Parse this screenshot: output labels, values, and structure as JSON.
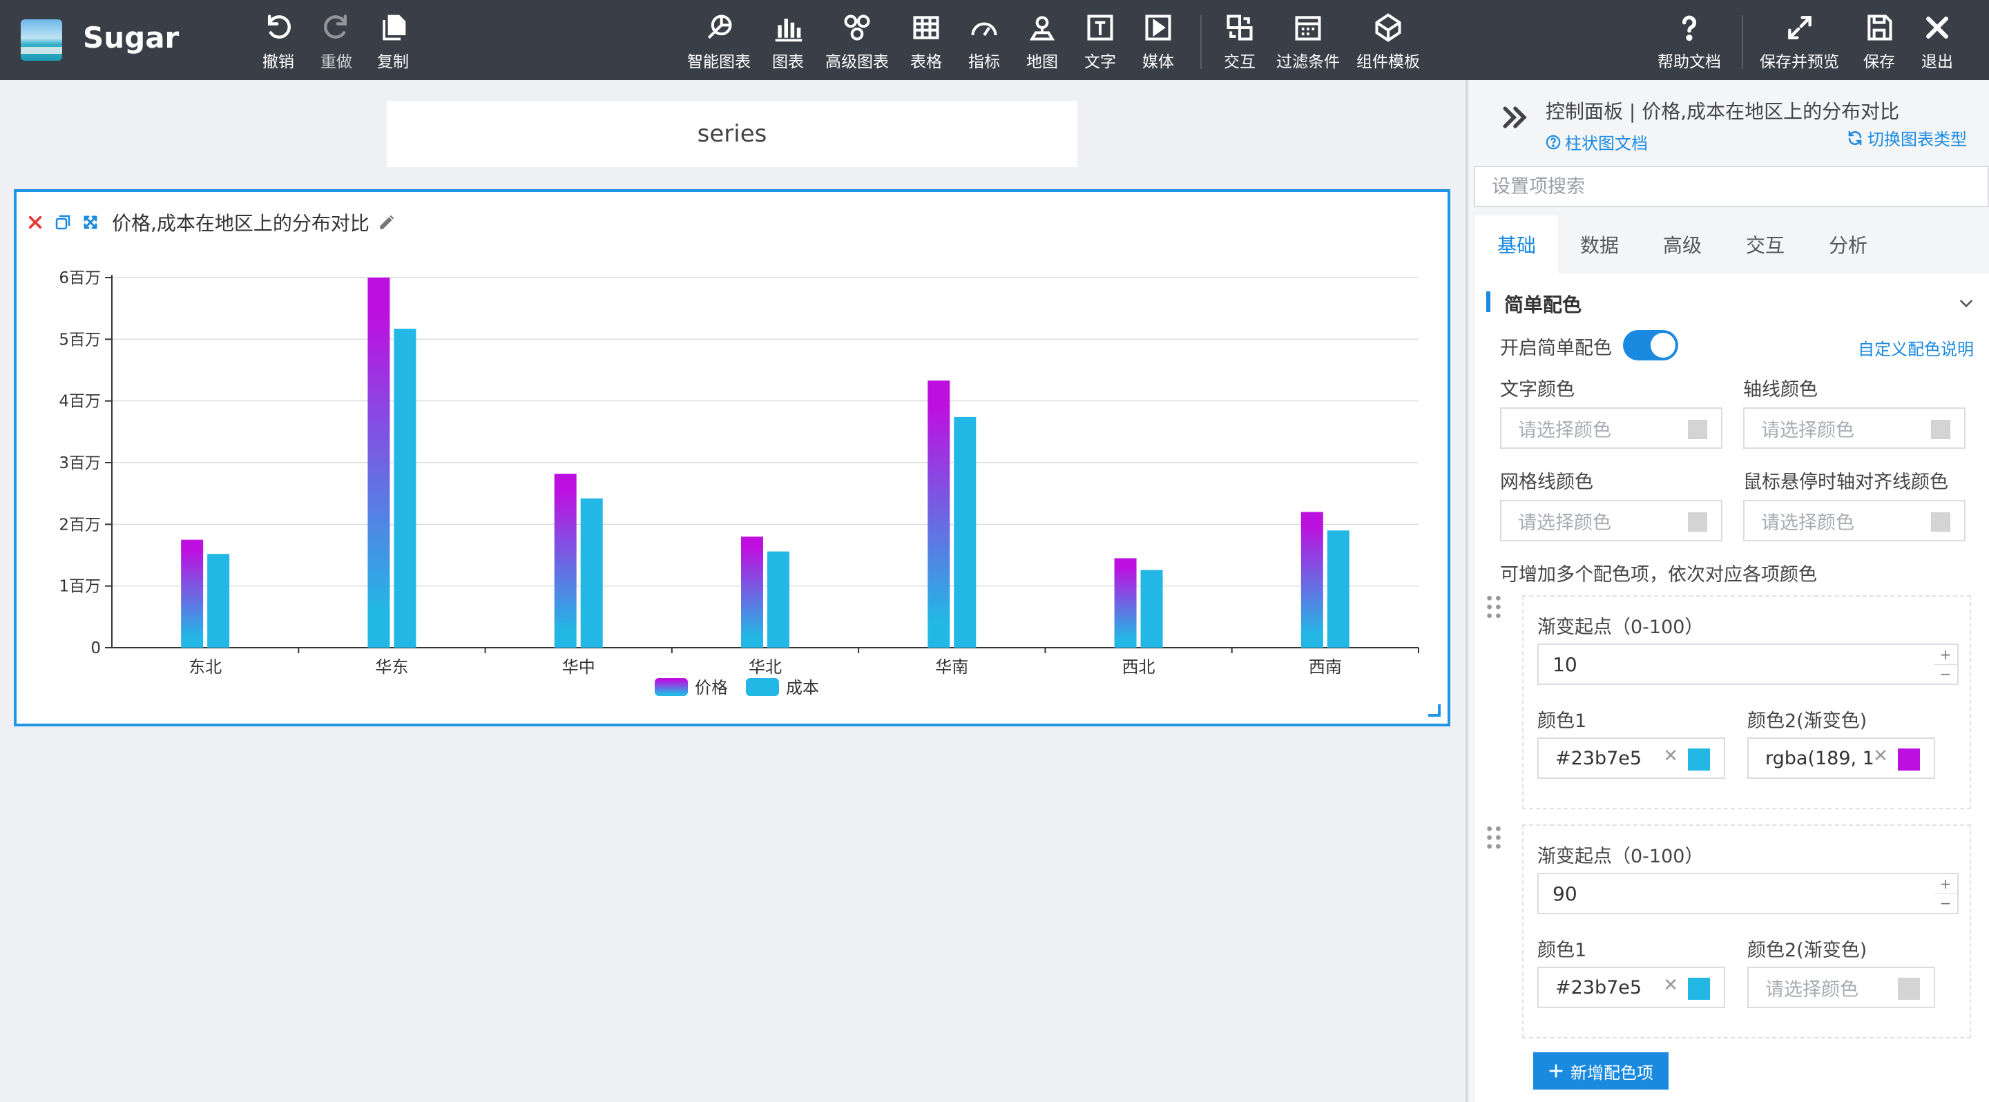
{
  "app": {
    "name": "Sugar"
  },
  "toolbar": {
    "left": [
      {
        "label": "撤销",
        "icon": "undo-icon"
      },
      {
        "label": "重做",
        "icon": "redo-icon"
      },
      {
        "label": "复制",
        "icon": "copy-icon"
      }
    ],
    "center": [
      {
        "label": "智能图表",
        "icon": "smart-chart-icon"
      },
      {
        "label": "图表",
        "icon": "bar-chart-icon"
      },
      {
        "label": "高级图表",
        "icon": "advanced-chart-icon"
      },
      {
        "label": "表格",
        "icon": "table-icon"
      },
      {
        "label": "指标",
        "icon": "gauge-icon"
      },
      {
        "label": "地图",
        "icon": "map-pin-icon"
      },
      {
        "label": "文字",
        "icon": "text-icon"
      },
      {
        "label": "媒体",
        "icon": "media-icon"
      },
      {
        "label": "交互",
        "icon": "interaction-icon"
      },
      {
        "label": "过滤条件",
        "icon": "filter-icon"
      },
      {
        "label": "组件模板",
        "icon": "template-icon"
      }
    ],
    "right": [
      {
        "label": "帮助文档",
        "icon": "help-icon"
      },
      {
        "label": "保存并预览",
        "icon": "expand-icon"
      },
      {
        "label": "保存",
        "icon": "save-icon"
      },
      {
        "label": "退出",
        "icon": "close-icon"
      }
    ]
  },
  "canvas": {
    "series_label": "series",
    "widget_title": "价格,成本在地区上的分布对比"
  },
  "chart_data": {
    "type": "bar",
    "categories": [
      "东北",
      "华东",
      "华中",
      "华北",
      "华南",
      "西北",
      "西南"
    ],
    "series": [
      {
        "name": "价格",
        "values": [
          1750000,
          6000000,
          2820000,
          1800000,
          4330000,
          1450000,
          2200000
        ],
        "gradient": [
          "#23b7e5",
          "#bd10e0"
        ]
      },
      {
        "name": "成本",
        "values": [
          1520000,
          5170000,
          2420000,
          1560000,
          3740000,
          1260000,
          1900000
        ],
        "color": "#23b7e5"
      }
    ],
    "yticks": [
      {
        "value": 0,
        "label": "0"
      },
      {
        "value": 1000000,
        "label": "1百万"
      },
      {
        "value": 2000000,
        "label": "2百万"
      },
      {
        "value": 3000000,
        "label": "3百万"
      },
      {
        "value": 4000000,
        "label": "4百万"
      },
      {
        "value": 5000000,
        "label": "5百万"
      },
      {
        "value": 6000000,
        "label": "6百万"
      }
    ],
    "ylim": [
      0,
      6000000
    ],
    "grid": true,
    "legend_position": "bottom-center"
  },
  "panel": {
    "title": "控制面板 | 价格,成本在地区上的分布对比",
    "doc_link": "柱状图文档",
    "switch_link": "切换图表类型",
    "search_placeholder": "设置项搜索",
    "tabs": [
      {
        "label": "基础",
        "active": true
      },
      {
        "label": "数据",
        "active": false
      },
      {
        "label": "高级",
        "active": false
      },
      {
        "label": "交互",
        "active": false
      },
      {
        "label": "分析",
        "active": false
      }
    ],
    "section_title": "简单配色",
    "enable_label": "开启简单配色",
    "enable_value": true,
    "custom_link": "自定义配色说明",
    "text_color_label": "文字颜色",
    "axis_color_label": "轴线颜色",
    "grid_color_label": "网格线颜色",
    "hover_color_label": "鼠标悬停时轴对齐线颜色",
    "color_placeholder": "请选择颜色",
    "multi_hint": "可增加多个配色项，依次对应各项颜色",
    "stop_label": "渐变起点（0-100）",
    "color1_label": "颜色1",
    "color2_label": "颜色2(渐变色)",
    "items": [
      {
        "stop": "10",
        "color1": "#23b7e5",
        "color1_swatch": "#23b7e5",
        "color2": "rgba(189, 16, 224, 1)",
        "color2_swatch": "#bd10e0"
      },
      {
        "stop": "90",
        "color1": "#23b7e5",
        "color1_swatch": "#23b7e5",
        "color2": "",
        "color2_swatch": ""
      }
    ],
    "add_button": "新增配色项"
  }
}
